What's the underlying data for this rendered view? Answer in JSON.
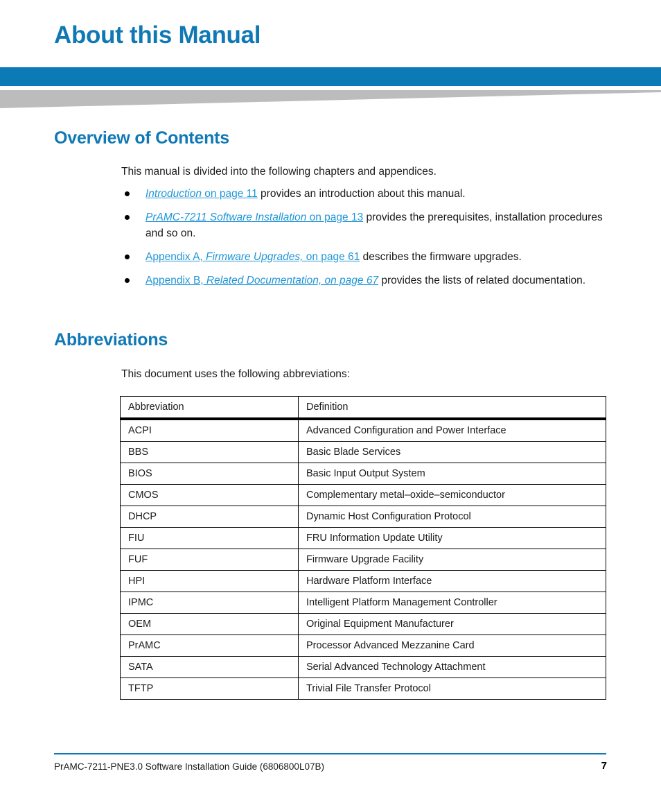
{
  "header": {
    "title": "About this Manual",
    "accent_color": "#1079b5",
    "bar_color": "#0b7ab5",
    "wedge_color": "#bcbcbc",
    "pattern_color": "#f2f2f2"
  },
  "sections": {
    "overview": {
      "heading": "Overview of Contents",
      "intro": "This manual is divided into the following chapters and appendices.",
      "bullets": [
        {
          "link_italic": "Introduction",
          "link_plain": " on page 11",
          "rest": " provides an introduction about this manual."
        },
        {
          "link_italic": "PrAMC-7211 Software Installation",
          "link_plain": " on page 13",
          "rest": " provides the prerequisites, installation procedures and so on."
        },
        {
          "link_plain_lead": "Appendix A, ",
          "link_italic": "Firmware Upgrades,",
          "link_plain": " on page 61",
          "rest": " describes the firmware upgrades."
        },
        {
          "link_plain_lead": "Appendix B, ",
          "link_italic": "Related Documentation, on page 67",
          "link_plain": "",
          "rest": " provides the lists of related documentation."
        }
      ]
    },
    "abbreviations": {
      "heading": "Abbreviations",
      "intro": "This document uses the following abbreviations:",
      "table": {
        "columns": [
          "Abbreviation",
          "Definition"
        ],
        "rows": [
          [
            "ACPI",
            "Advanced Configuration and Power Interface"
          ],
          [
            "BBS",
            "Basic Blade Services"
          ],
          [
            "BIOS",
            "Basic Input Output System"
          ],
          [
            "CMOS",
            "Complementary metal–oxide–semiconductor"
          ],
          [
            "DHCP",
            "Dynamic Host Configuration Protocol"
          ],
          [
            "FIU",
            "FRU Information Update Utility"
          ],
          [
            "FUF",
            "Firmware Upgrade Facility"
          ],
          [
            "HPI",
            "Hardware Platform Interface"
          ],
          [
            "IPMC",
            " Intelligent Platform Management Controller"
          ],
          [
            "OEM",
            "Original Equipment Manufacturer"
          ],
          [
            "PrAMC",
            "Processor Advanced Mezzanine Card"
          ],
          [
            "SATA",
            "Serial Advanced Technology Attachment"
          ],
          [
            "TFTP",
            "Trivial File Transfer Protocol"
          ]
        ]
      }
    }
  },
  "footer": {
    "document_title": "PrAMC-7211-PNE3.0 Software Installation Guide (6806800L07B)",
    "page_number": "7",
    "rule_color": "#1079b5"
  }
}
